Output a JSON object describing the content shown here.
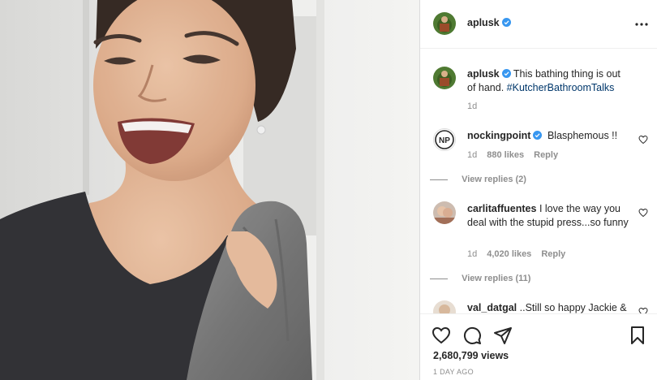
{
  "header": {
    "username": "aplusk",
    "verified": true
  },
  "caption": {
    "username": "aplusk",
    "text": "This bathing thing is out of hand. ",
    "hashtag": "#KutcherBathroomTalks",
    "time": "1d"
  },
  "comments": [
    {
      "username": "nockingpoint",
      "verified": true,
      "text": "Blasphemous !!",
      "time": "1d",
      "likes": "880 likes",
      "reply_label": "Reply",
      "view_replies": "View replies (2)",
      "avatar_text": "NP"
    },
    {
      "username": "carlitaffuentes",
      "verified": false,
      "text": "I love the way you deal with the stupid press...so funny",
      "time": "1d",
      "likes": "4,020 likes",
      "reply_label": "Reply",
      "view_replies": "View replies (11)"
    },
    {
      "username": "val_datgal",
      "verified": false,
      "text": "..Still so happy Jackie &"
    }
  ],
  "actions": {
    "views": "2,680,799 views",
    "posted": "1 DAY AGO"
  },
  "icons": [
    "verified-badge-icon",
    "more-options-icon",
    "heart-icon",
    "comment-icon",
    "share-icon",
    "bookmark-icon"
  ],
  "colors": {
    "verified": "#3897f0",
    "hashtag": "#00376b",
    "muted": "#8e8e8e",
    "text": "#262626"
  }
}
